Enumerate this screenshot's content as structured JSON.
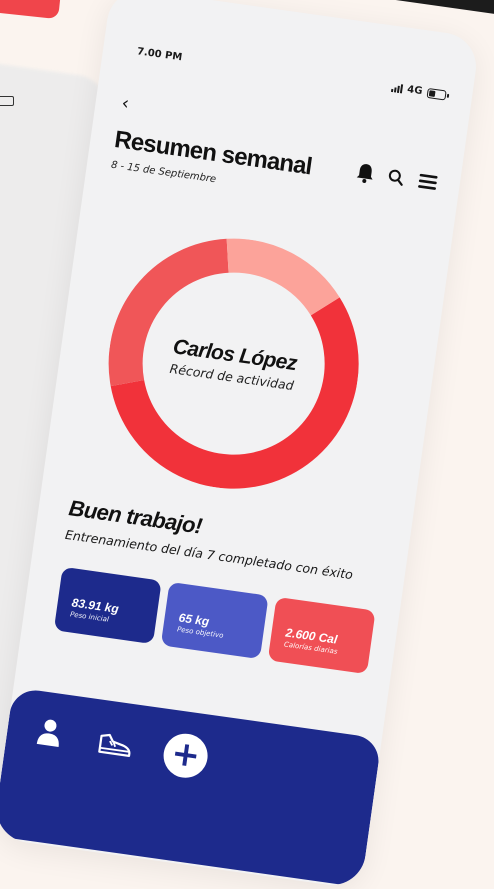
{
  "status": {
    "time": "7.00 PM",
    "network": "4G"
  },
  "header": {
    "back_icon": "chevron-left-icon",
    "title": "Resumen semanal",
    "date_range": "8 - 15 de Septiembre",
    "icons": [
      "bell-icon",
      "search-icon",
      "menu-icon"
    ]
  },
  "summary_ring": {
    "name": "Carlos López",
    "label": "Récord de actividad",
    "segments": [
      {
        "color": "#f1323a",
        "fraction": 0.56
      },
      {
        "color": "#f05658",
        "fraction": 0.27
      },
      {
        "color": "#fca39a",
        "fraction": 0.17
      }
    ]
  },
  "message": {
    "title": "Buen trabajo!",
    "subtitle": "Entrenamiento del día 7 completado con éxito"
  },
  "stats": [
    {
      "value": "83.91 kg",
      "caption": "Peso inicial",
      "color": "#1d2a8c"
    },
    {
      "value": "65 kg",
      "caption": "Peso objetivo",
      "color": "#4c59c6"
    },
    {
      "value": "2.600 Cal",
      "caption": "Calorías diarias",
      "color": "#f04f55"
    }
  ],
  "nav": {
    "icons": [
      "user-icon",
      "shoe-icon",
      "plus-icon"
    ]
  },
  "colors": {
    "primary": "#1d2a8c",
    "accent": "#f1323a",
    "background": "#f2f2f3"
  }
}
